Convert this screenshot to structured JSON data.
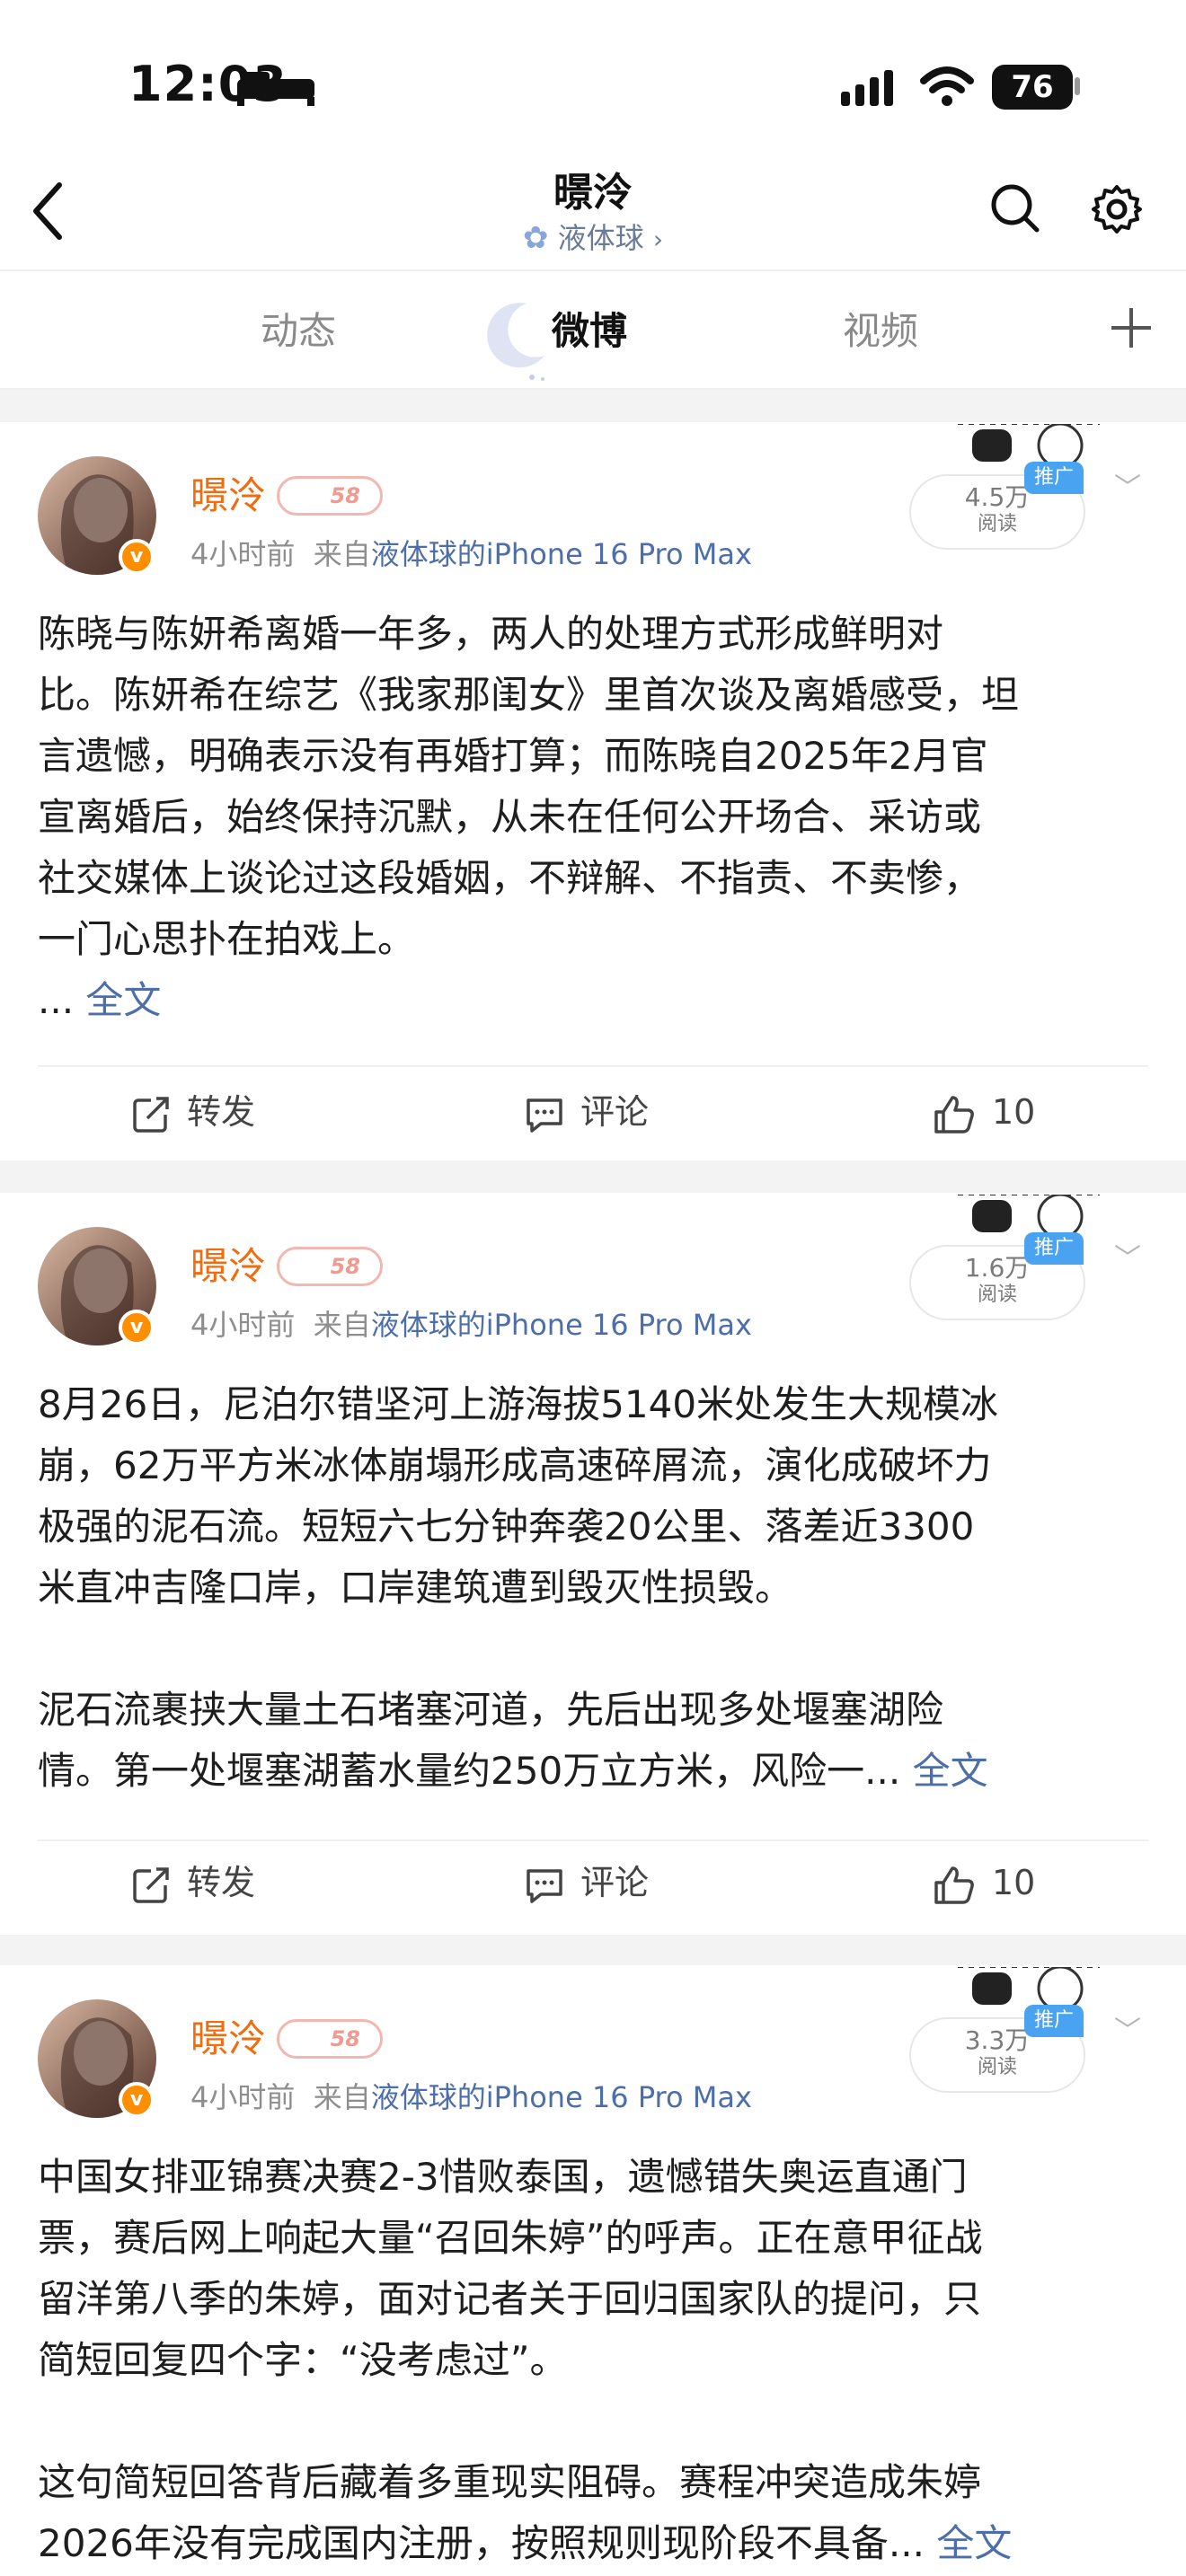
{
  "status_bar": {
    "time": "12:03",
    "battery": "76"
  },
  "header": {
    "title": "暻泠",
    "subtitle": "液体球",
    "icons": [
      "back-icon",
      "search-icon",
      "gear-icon"
    ]
  },
  "tabs": [
    {
      "label": "动态",
      "active": false
    },
    {
      "label": "微博",
      "active": true
    },
    {
      "label": "视频",
      "active": false
    }
  ],
  "colors": {
    "accent_orange": "#f26b0e",
    "link_blue": "#4d6ea8",
    "ad_blue": "#4aa3f0"
  },
  "posts": [
    {
      "username": "暻泠",
      "level": "58",
      "time": "4小时前",
      "from_label": "来自",
      "source": "液体球的iPhone 16 Pro Max",
      "reads_count": "4.5万",
      "reads_label": "阅读",
      "ad_tag": "推广",
      "body": [
        "陈晓与陈妍希离婚一年多，两人的处理方式形成鲜明对",
        "比。陈妍希在综艺《我家那闺女》里首次谈及离婚感受，坦",
        "言遗憾，明确表示没有再婚打算；而陈晓自2025年2月官",
        "宣离婚后，始终保持沉默，从未在任何公开场合、采访或",
        "社交媒体上谈论过这段婚姻，不辩解、不指责、不卖惨，",
        "一门心思扑在拍戏上。"
      ],
      "ellipsis": "...",
      "full_text": "全文",
      "repost": "转发",
      "comment": "评论",
      "likes": "10"
    },
    {
      "username": "暻泠",
      "level": "58",
      "time": "4小时前",
      "from_label": "来自",
      "source": "液体球的iPhone 16 Pro Max",
      "reads_count": "1.6万",
      "reads_label": "阅读",
      "ad_tag": "推广",
      "body": [
        "8月26日，尼泊尔错坚河上游海拔5140米处发生大规模冰",
        "崩，62万平方米冰体崩塌形成高速碎屑流，演化成破坏力",
        "极强的泥石流。短短六七分钟奔袭20公里、落差近3300",
        "米直冲吉隆口岸，口岸建筑遭到毁灭性损毁。",
        "",
        "泥石流裹挟大量土石堵塞河道，先后出现多处堰塞湖险",
        "情。第一处堰塞湖蓄水量约250万立方米，风险一..."
      ],
      "full_text": "全文",
      "repost": "转发",
      "comment": "评论",
      "likes": "10"
    },
    {
      "username": "暻泠",
      "level": "58",
      "time": "4小时前",
      "from_label": "来自",
      "source": "液体球的iPhone 16 Pro Max",
      "reads_count": "3.3万",
      "reads_label": "阅读",
      "ad_tag": "推广",
      "body": [
        "中国女排亚锦赛决赛2-3惜败泰国，遗憾错失奥运直通门",
        "票，赛后网上响起大量“召回朱婷”的呼声。正在意甲征战",
        "留洋第八季的朱婷，面对记者关于回归国家队的提问，只",
        "简短回复四个字：“没考虑过”。",
        "",
        "这句简短回答背后藏着多重现实阻碍。赛程冲突造成朱婷",
        "2026年没有完成国内注册，按照规则现阶段不具备..."
      ],
      "full_text": "全文"
    }
  ]
}
